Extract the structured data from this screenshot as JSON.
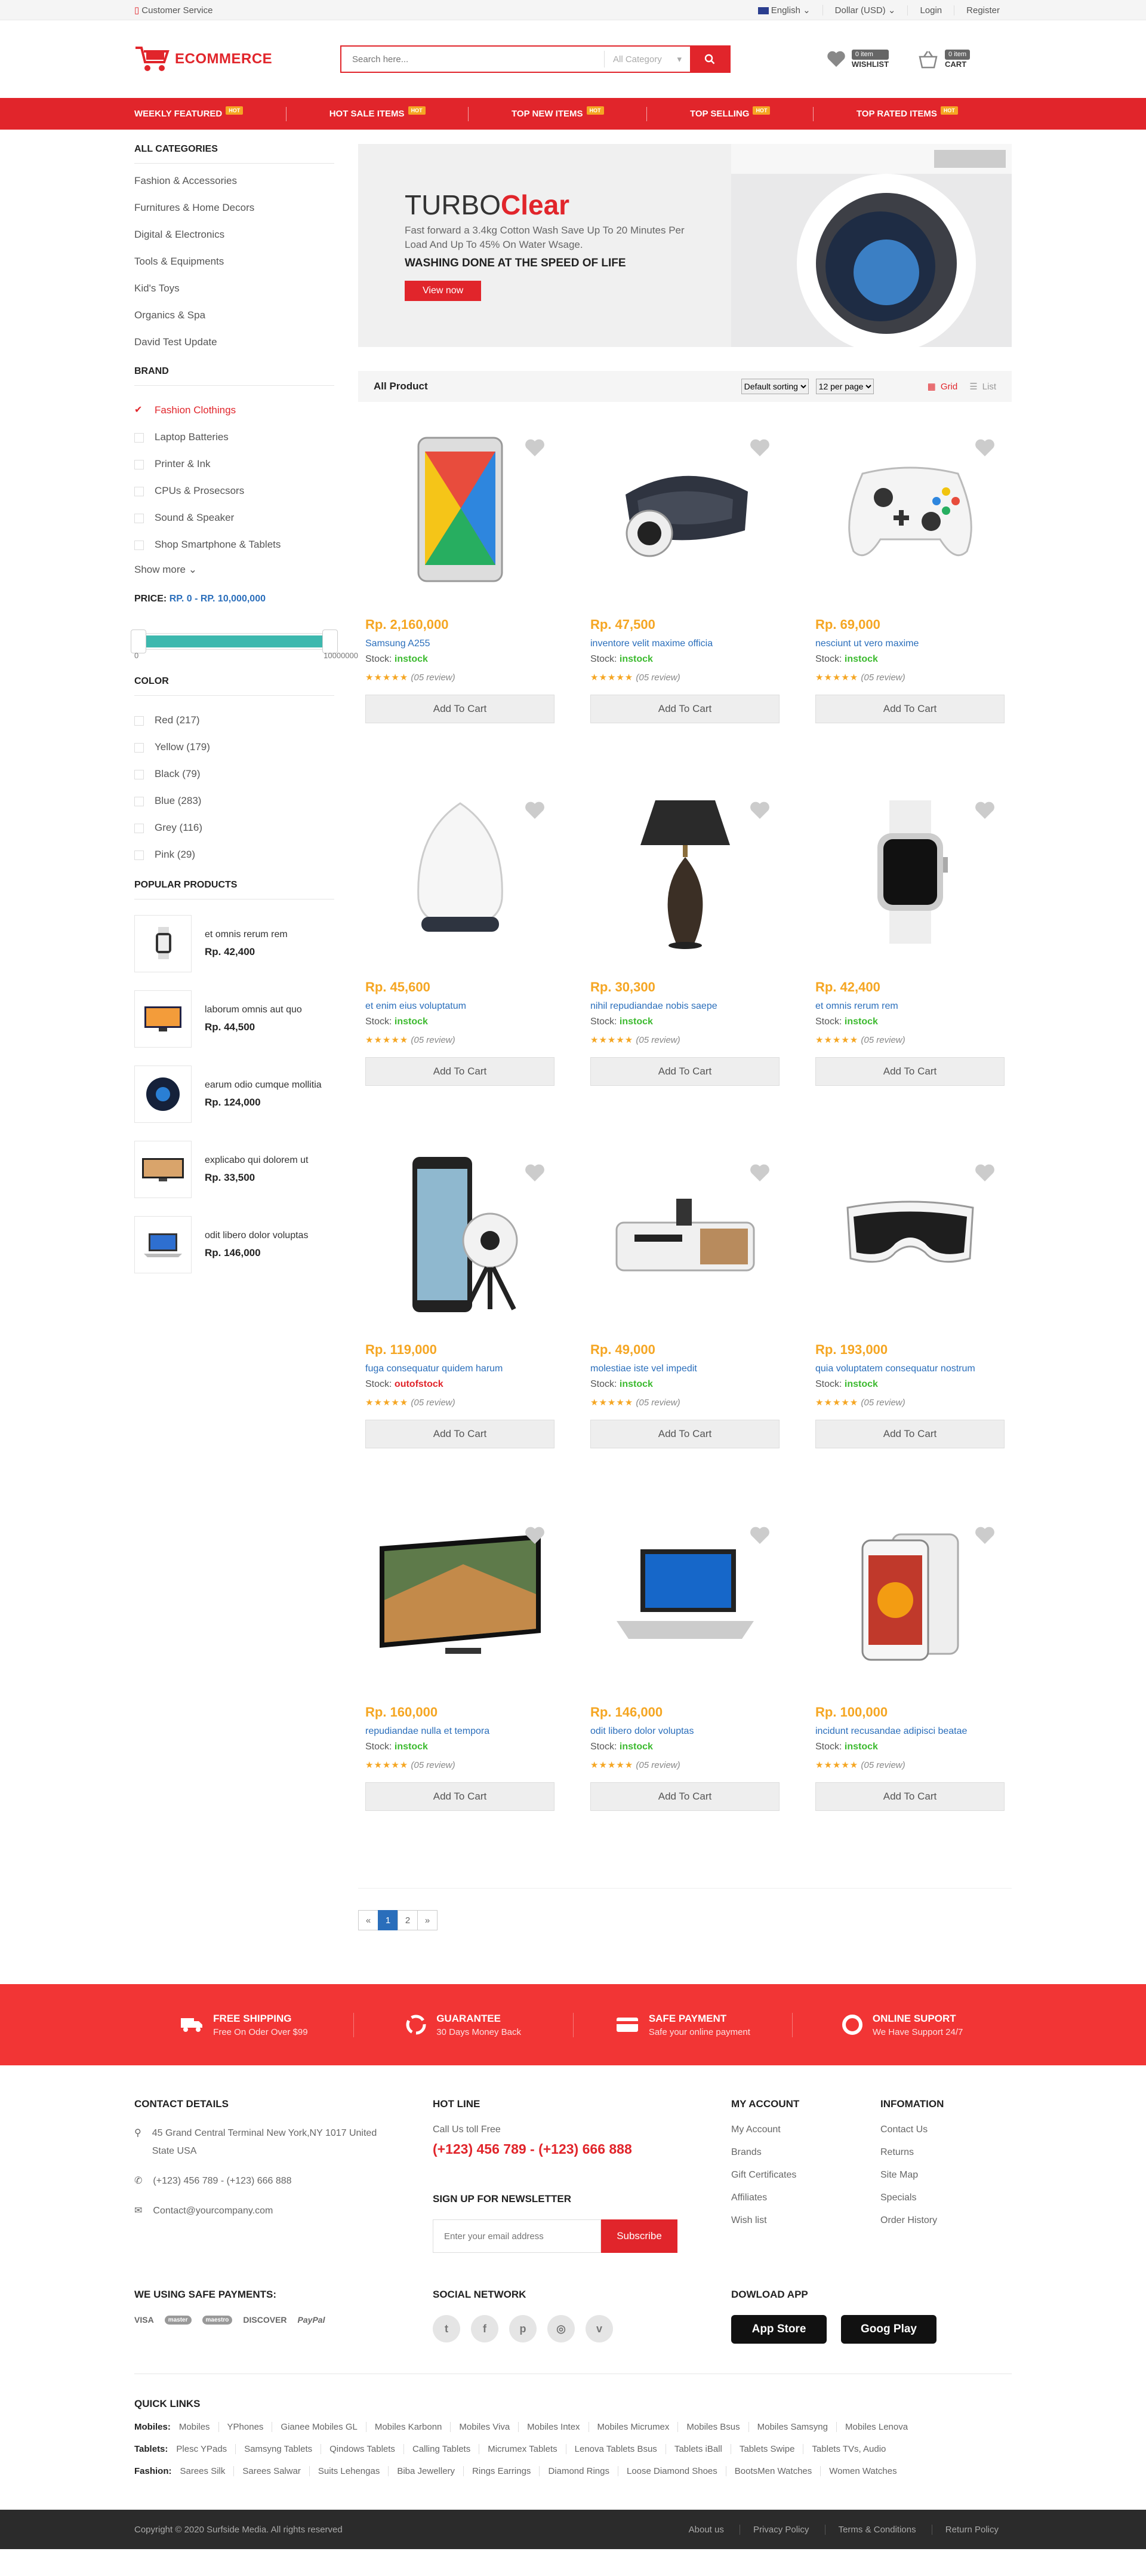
{
  "topbar": {
    "customer_service": "Customer Service",
    "language": "English",
    "currency": "Dollar (USD)",
    "login": "Login",
    "register": "Register"
  },
  "header": {
    "logo": "ECOMMERCE",
    "search_placeholder": "Search here...",
    "category": "All Category",
    "wishlist_count": "0 item",
    "wishlist_label": "WISHLIST",
    "cart_count": "0 item",
    "cart_label": "CART"
  },
  "nav": [
    {
      "label": "WEEKLY FEATURED",
      "badge": "HOT"
    },
    {
      "label": "HOT SALE ITEMS",
      "badge": "HOT"
    },
    {
      "label": "TOP NEW ITEMS",
      "badge": "HOT"
    },
    {
      "label": "TOP SELLING",
      "badge": "HOT"
    },
    {
      "label": "TOP RATED ITEMS",
      "badge": "HOT"
    }
  ],
  "sidebar": {
    "categories_title": "ALL CATEGORIES",
    "categories": [
      "Fashion & Accessories",
      "Furnitures & Home Decors",
      "Digital & Electronics",
      "Tools & Equipments",
      "Kid's Toys",
      "Organics & Spa",
      "David Test Update"
    ],
    "brand_title": "BRAND",
    "brands": [
      "Fashion Clothings",
      "Laptop Batteries",
      "Printer & Ink",
      "CPUs & Prosecsors",
      "Sound & Speaker",
      "Shop Smartphone & Tablets"
    ],
    "show_more": "Show more",
    "price_title": "PRICE:",
    "price_range": "RP. 0 - RP. 10,000,000",
    "price_min": "0",
    "price_max": "10000000",
    "color_title": "COLOR",
    "colors": [
      "Red (217)",
      "Yellow (179)",
      "Black (79)",
      "Blue (283)",
      "Grey (116)",
      "Pink (29)"
    ],
    "popular_title": "POPULAR PRODUCTS",
    "popular": [
      {
        "name": "et omnis rerum rem",
        "price": "Rp. 42,400"
      },
      {
        "name": "laborum omnis aut quo",
        "price": "Rp. 44,500"
      },
      {
        "name": "earum odio cumque mollitia",
        "price": "Rp. 124,000"
      },
      {
        "name": "explicabo qui dolorem ut",
        "price": "Rp. 33,500"
      },
      {
        "name": "odit libero dolor voluptas",
        "price": "Rp. 146,000"
      }
    ]
  },
  "banner": {
    "title_a": "TURBO",
    "title_b": "Clear",
    "desc": "Fast forward a 3.4kg Cotton Wash Save Up To 20 Minutes Per Load And Up To 45% On Water Wsage.",
    "tagline": "WASHING DONE AT THE SPEED OF LIFE",
    "button": "View now"
  },
  "toolbar": {
    "title": "All Product",
    "sorting": "Default sorting",
    "per_page": "12 per page",
    "grid": "Grid",
    "list": "List"
  },
  "products": [
    {
      "price": "Rp. 2,160,000",
      "name": "Samsung A255",
      "stock_label": "Stock:",
      "stock": "instock",
      "reviews": "(05 review)",
      "add": "Add To Cart",
      "icon": "tablet"
    },
    {
      "price": "Rp. 47,500",
      "name": "inventore velit maxime officia",
      "stock_label": "Stock:",
      "stock": "instock",
      "reviews": "(05 review)",
      "add": "Add To Cart",
      "icon": "vr-headset"
    },
    {
      "price": "Rp. 69,000",
      "name": "nesciunt ut vero maxime",
      "stock_label": "Stock:",
      "stock": "instock",
      "reviews": "(05 review)",
      "add": "Add To Cart",
      "icon": "gamepad"
    },
    {
      "price": "Rp. 45,600",
      "name": "et enim eius voluptatum",
      "stock_label": "Stock:",
      "stock": "instock",
      "reviews": "(05 review)",
      "add": "Add To Cart",
      "icon": "speaker"
    },
    {
      "price": "Rp. 30,300",
      "name": "nihil repudiandae nobis saepe",
      "stock_label": "Stock:",
      "stock": "instock",
      "reviews": "(05 review)",
      "add": "Add To Cart",
      "icon": "lamp"
    },
    {
      "price": "Rp. 42,400",
      "name": "et omnis rerum rem",
      "stock_label": "Stock:",
      "stock": "instock",
      "reviews": "(05 review)",
      "add": "Add To Cart",
      "icon": "watch"
    },
    {
      "price": "Rp. 119,000",
      "name": "fuga consequatur quidem harum",
      "stock_label": "Stock:",
      "stock": "outofstock",
      "reviews": "(05 review)",
      "add": "Add To Cart",
      "icon": "camera"
    },
    {
      "price": "Rp. 49,000",
      "name": "molestiae iste vel impedit",
      "stock_label": "Stock:",
      "stock": "instock",
      "reviews": "(05 review)",
      "add": "Add To Cart",
      "icon": "radio"
    },
    {
      "price": "Rp. 193,000",
      "name": "quia voluptatem consequatur nostrum",
      "stock_label": "Stock:",
      "stock": "instock",
      "reviews": "(05 review)",
      "add": "Add To Cart",
      "icon": "vr-goggles"
    },
    {
      "price": "Rp. 160,000",
      "name": "repudiandae nulla et tempora",
      "stock_label": "Stock:",
      "stock": "instock",
      "reviews": "(05 review)",
      "add": "Add To Cart",
      "icon": "tv"
    },
    {
      "price": "Rp. 146,000",
      "name": "odit libero dolor voluptas",
      "stock_label": "Stock:",
      "stock": "instock",
      "reviews": "(05 review)",
      "add": "Add To Cart",
      "icon": "laptop"
    },
    {
      "price": "Rp. 100,000",
      "name": "incidunt recusandae adipisci beatae",
      "stock_label": "Stock:",
      "stock": "instock",
      "reviews": "(05 review)",
      "add": "Add To Cart",
      "icon": "phone"
    }
  ],
  "pagination": {
    "prev": "«",
    "pages": [
      "1",
      "2"
    ],
    "next": "»"
  },
  "services": [
    {
      "title": "FREE SHIPPING",
      "sub": "Free On Oder Over $99"
    },
    {
      "title": "GUARANTEE",
      "sub": "30 Days Money Back"
    },
    {
      "title": "SAFE PAYMENT",
      "sub": "Safe your online payment"
    },
    {
      "title": "ONLINE SUPORT",
      "sub": "We Have Support 24/7"
    }
  ],
  "footer": {
    "contact_title": "CONTACT DETAILS",
    "address": "45 Grand Central Terminal New York,NY 1017 United State USA",
    "phone": "(+123) 456 789 - (+123) 666 888",
    "email": "Contact@yourcompany.com",
    "hotline_title": "HOT LINE",
    "hotline_sub": "Call Us toll Free",
    "hotline_num": "(+123) 456 789 - (+123) 666 888",
    "newsletter_title": "SIGN UP FOR NEWSLETTER",
    "newsletter_placeholder": "Enter your email address",
    "subscribe": "Subscribe",
    "account_title": "MY ACCOUNT",
    "account": [
      "My Account",
      "Brands",
      "Gift Certificates",
      "Affiliates",
      "Wish list"
    ],
    "info_title": "INFOMATION",
    "info": [
      "Contact Us",
      "Returns",
      "Site Map",
      "Specials",
      "Order History"
    ],
    "payments_title": "WE USING SAFE PAYMENTS:",
    "payments": [
      "VISA",
      "master",
      "maestro",
      "DISCOVER",
      "PayPal"
    ],
    "social_title": "SOCIAL NETWORK",
    "app_title": "DOWLOAD APP",
    "app_store": "App Store",
    "google_play": "Goog Play",
    "quick_title": "QUICK LINKS",
    "quick_mobiles_label": "Mobiles:",
    "quick_mobiles": [
      "Mobiles",
      "YPhones",
      "Gianee Mobiles GL",
      "Mobiles Karbonn",
      "Mobiles Viva",
      "Mobiles Intex",
      "Mobiles Micrumex",
      "Mobiles Bsus",
      "Mobiles Samsyng",
      "Mobiles Lenova"
    ],
    "quick_tablets_label": "Tablets:",
    "quick_tablets": [
      "Plesc YPads",
      "Samsyng Tablets",
      "Qindows Tablets",
      "Calling Tablets",
      "Micrumex Tablets",
      "Lenova Tablets Bsus",
      "Tablets iBall",
      "Tablets Swipe",
      "Tablets TVs, Audio"
    ],
    "quick_fashion_label": "Fashion:",
    "quick_fashion": [
      "Sarees Silk",
      "Sarees Salwar",
      "Suits Lehengas",
      "Biba Jewellery",
      "Rings Earrings",
      "Diamond Rings",
      "Loose Diamond Shoes",
      "BootsMen Watches",
      "Women Watches"
    ],
    "copyright": "Copyright © 2020 Surfside Media. All rights reserved",
    "bottom_links": [
      "About us",
      "Privacy Policy",
      "Terms & Conditions",
      "Return Policy"
    ]
  },
  "colors": {
    "brand": "#e1252b",
    "price": "#f5a623",
    "link": "#2a6ebb",
    "instock": "#3cba2f"
  }
}
